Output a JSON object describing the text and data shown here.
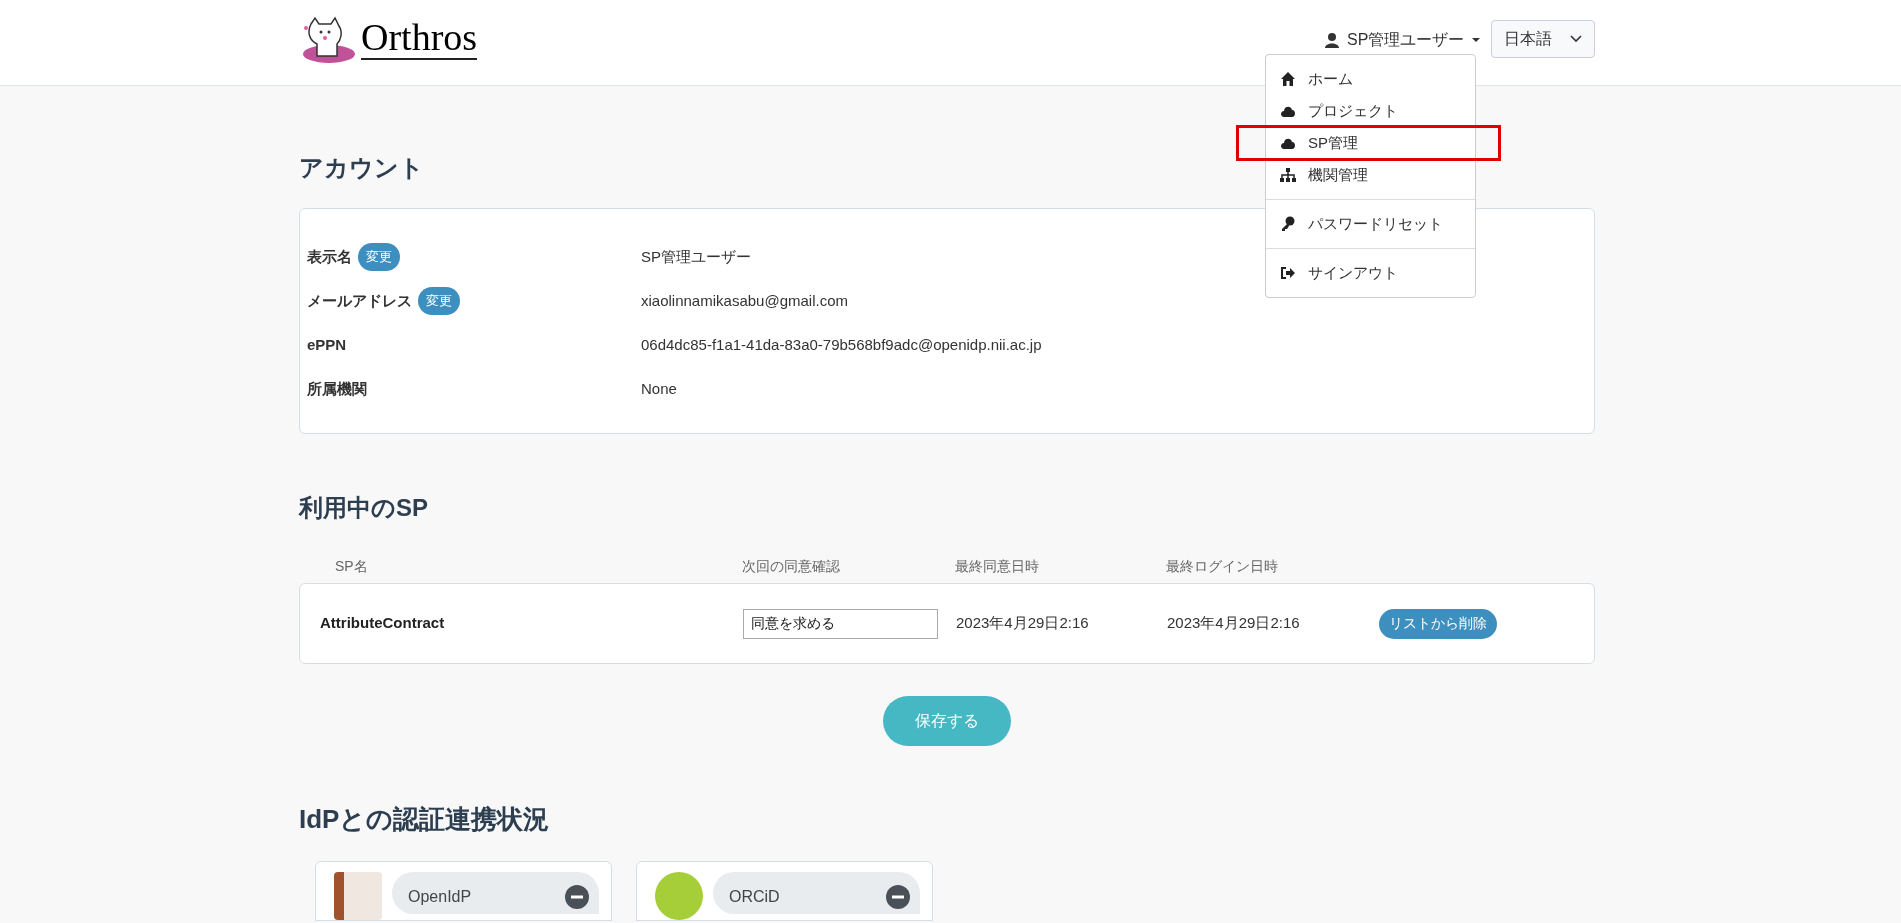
{
  "header": {
    "logo": "Orthros",
    "user_menu": "SP管理ユーザー",
    "language": "日本語"
  },
  "user_dropdown": {
    "groups": [
      [
        {
          "kind": "home",
          "label": "ホーム",
          "highlighted": false
        },
        {
          "kind": "project",
          "label": "プロジェクト",
          "highlighted": false
        },
        {
          "kind": "sp",
          "label": "SP管理",
          "highlighted": true
        },
        {
          "kind": "institution",
          "label": "機関管理",
          "highlighted": false
        }
      ],
      [
        {
          "kind": "password",
          "label": "パスワードリセット",
          "highlighted": false
        }
      ],
      [
        {
          "kind": "signout",
          "label": "サインアウト",
          "highlighted": false
        }
      ]
    ]
  },
  "account": {
    "title": "アカウント",
    "rows": [
      {
        "label": "表示名",
        "action": "変更",
        "value": "SP管理ユーザー"
      },
      {
        "label": "メールアドレス",
        "action": "変更",
        "value": "xiaolinnamikasabu@gmail.com"
      },
      {
        "label": "ePPN",
        "value": "06d4dc85-f1a1-41da-83a0-79b568bf9adc@openidp.nii.ac.jp"
      },
      {
        "label": "所属機関",
        "value": "None"
      }
    ]
  },
  "sp_in_use": {
    "title": "利用中のSP",
    "columns": [
      "SP名",
      "次回の同意確認",
      "最終同意日時",
      "最終ログイン日時"
    ],
    "rows": [
      {
        "name": "AttributeContract",
        "consent": "同意を求める",
        "last_consent": "2023年4月29日2:16",
        "last_login": "2023年4月29日2:16",
        "action": "リストから削除"
      }
    ],
    "save_button": "保存する"
  },
  "idp_status": {
    "title": "IdPとの認証連携状況",
    "cards": [
      {
        "kind": "openidp",
        "name": "OpenIdP"
      },
      {
        "kind": "orcid",
        "name": "ORCiD"
      }
    ]
  }
}
